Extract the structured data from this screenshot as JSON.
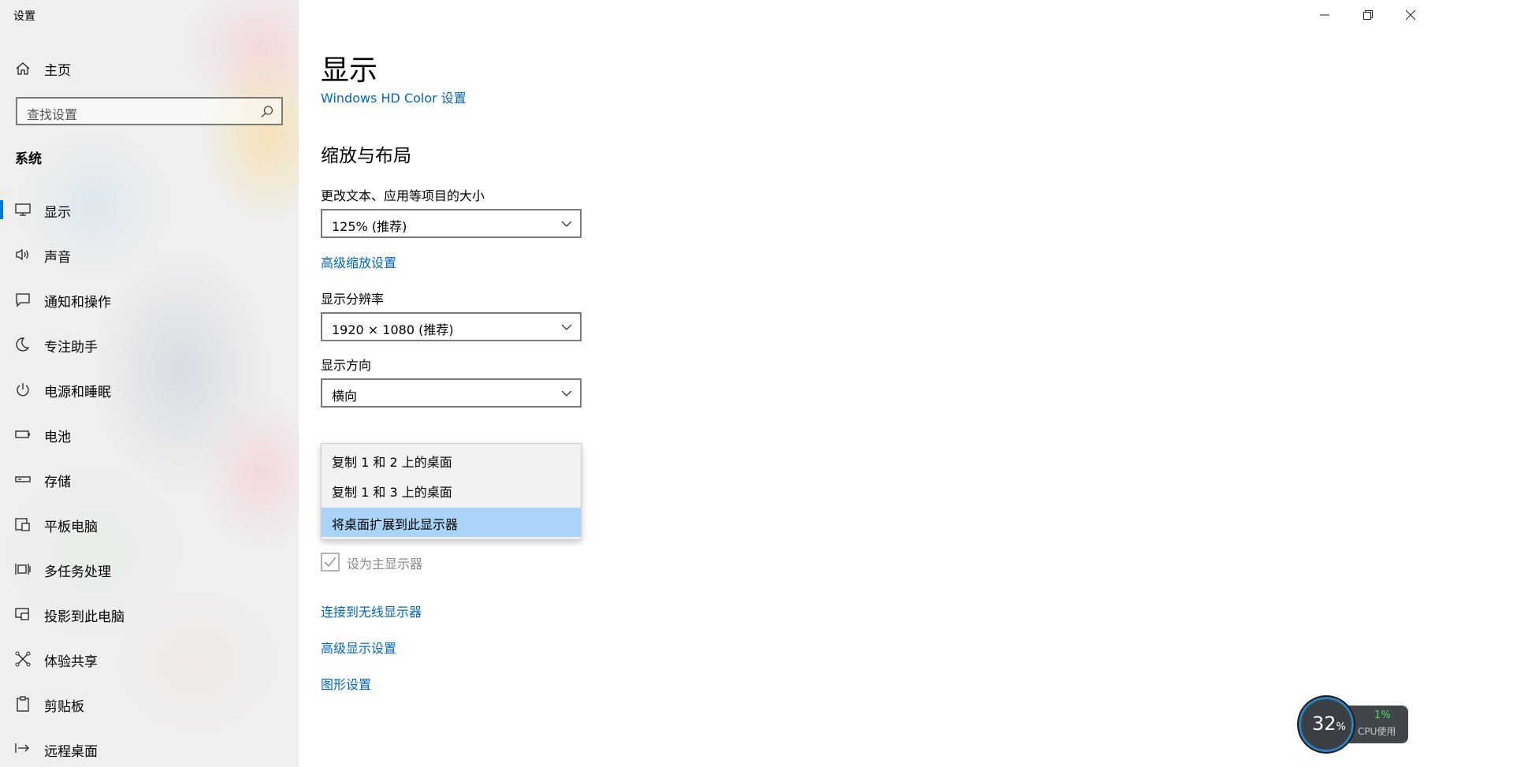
{
  "window": {
    "title": "设置",
    "minimize_icon": "minimize-icon",
    "restore_icon": "restore-icon",
    "close_icon": "close-icon"
  },
  "sidebar": {
    "home": {
      "label": "主页",
      "icon": "home-icon"
    },
    "search": {
      "placeholder": "查找设置",
      "icon": "search-icon"
    },
    "section_title": "系统",
    "items": [
      {
        "label": "显示",
        "icon": "monitor-icon",
        "active": true
      },
      {
        "label": "声音",
        "icon": "speaker-icon"
      },
      {
        "label": "通知和操作",
        "icon": "notification-icon"
      },
      {
        "label": "专注助手",
        "icon": "moon-icon"
      },
      {
        "label": "电源和睡眠",
        "icon": "power-icon"
      },
      {
        "label": "电池",
        "icon": "battery-icon"
      },
      {
        "label": "存储",
        "icon": "storage-icon"
      },
      {
        "label": "平板电脑",
        "icon": "tablet-icon"
      },
      {
        "label": "多任务处理",
        "icon": "multitasking-icon"
      },
      {
        "label": "投影到此电脑",
        "icon": "project-icon"
      },
      {
        "label": "体验共享",
        "icon": "share-icon"
      },
      {
        "label": "剪贴板",
        "icon": "clipboard-icon"
      },
      {
        "label": "远程桌面",
        "icon": "remote-desktop-icon"
      }
    ]
  },
  "main": {
    "page_title": "显示",
    "hd_color_link": "Windows HD Color 设置",
    "scale_section_title": "缩放与布局",
    "scale_label": "更改文本、应用等项目的大小",
    "scale_value": "125% (推荐)",
    "advanced_scaling_link": "高级缩放设置",
    "resolution_label": "显示分辨率",
    "resolution_value": "1920 × 1080 (推荐)",
    "orientation_label": "显示方向",
    "orientation_value": "横向",
    "multi_display_options": [
      "复制 1 和 2 上的桌面",
      "复制 1 和 3 上的桌面",
      "将桌面扩展到此显示器"
    ],
    "multi_display_selected": "将桌面扩展到此显示器",
    "main_display_checkbox_label": "设为主显示器",
    "main_display_checked": true,
    "wireless_link": "连接到无线显示器",
    "advanced_display_link": "高级显示设置",
    "graphics_link": "图形设置"
  },
  "cpu_widget": {
    "usage_value": "32",
    "usage_unit": "%",
    "cpu_value": "1%",
    "cpu_label": "CPU使用",
    "colors": {
      "accent": "#4cd964",
      "ring": "#2c7fb8"
    }
  },
  "colors": {
    "accent": "#0078d4",
    "link": "#0067c0",
    "selection": "#a9d4f7"
  }
}
